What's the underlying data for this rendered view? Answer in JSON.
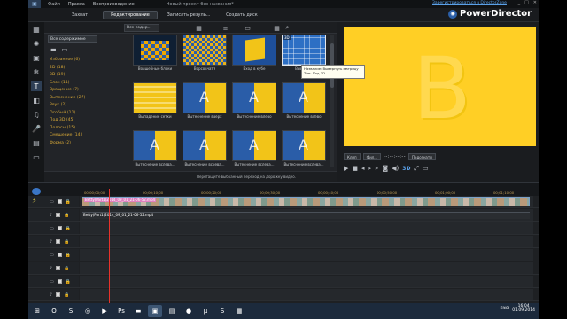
{
  "app": {
    "menu": [
      "Файл",
      "Правка",
      "Воспроизведение"
    ],
    "project_title": "Новый проект без названия*",
    "register_link": "Зарегистрироваться в DirectorZone",
    "brand": "PowerDirector",
    "window_buttons": [
      "_",
      "□",
      "✕"
    ]
  },
  "tabs": [
    {
      "label": "Захват",
      "active": false
    },
    {
      "label": "Редактирование",
      "active": true
    },
    {
      "label": "Записать резуль...",
      "active": false
    },
    {
      "label": "Создать диск",
      "active": false
    }
  ],
  "library": {
    "dropdown1": "Все содер...",
    "dropdown2": "Все содержимое",
    "categories": [
      "Избранное (6)",
      "2D (18)",
      "3D (19)",
      "Блок (11)",
      "Вращение (7)",
      "Вытеснение (27)",
      "Звук (2)",
      "Особый (11)",
      "Под 3D (45)",
      "Полосы (15)",
      "Смещение (14)",
      "Форма (2)"
    ],
    "thumbnails": [
      {
        "label": "Волшебные блоки",
        "style": "blocks"
      },
      {
        "label": "Ворсовчатя",
        "style": "mosaic"
      },
      {
        "label": "Вход в кубе",
        "style": "cube"
      },
      {
        "label": "Выверн...",
        "style": "grid3d",
        "badge": "3D",
        "selected": true
      },
      {
        "label": "Выпадение сетки",
        "style": "stripes"
      },
      {
        "label": "Вытеснение вверх",
        "style": "swipe"
      },
      {
        "label": "Вытеснение влево",
        "style": "swipe"
      },
      {
        "label": "Вытеснение влево",
        "style": "swipe"
      },
      {
        "label": "Вытеснение вслева...",
        "style": "swipe"
      },
      {
        "label": "Вытеснение вслева...",
        "style": "swipe"
      },
      {
        "label": "Вытеснение вслева...",
        "style": "swipe"
      },
      {
        "label": "Вытеснение вслева...",
        "style": "swipe"
      }
    ],
    "tooltip_name": "Название: Вывернуть матрицу",
    "tooltip_type": "Тип: Под 3D",
    "hint": "Перетащите выбранный переход на дорожку видео."
  },
  "preview": {
    "big_letter": "B",
    "mode_clip": "Клип",
    "mode_film": "Фил...",
    "timecode": "--:--:--:--",
    "fit_button": "Подогнати",
    "d3_label": "3D"
  },
  "timeline": {
    "ruler": [
      "00;00;00;00",
      "00;00;10;00",
      "00;00;20;00",
      "00;00;30;00",
      "00;00;40;00",
      "00;00;50;00",
      "00;01;00;00",
      "00;01;10;00"
    ],
    "clip_label_video": "Betty(Part1)2014_09_01_21-06-52.mp4",
    "clip_label_audio": "Betty(Part1)2014_09_01_21-06-52.mp4",
    "track_count": 8
  },
  "taskbar": {
    "icons": [
      "start-icon",
      "opera-icon",
      "skype-icon",
      "browser-icon",
      "media-icon",
      "photoshop-icon",
      "folder-icon",
      "powerdirector-icon",
      "explorer-icon",
      "record-icon",
      "torrent-icon",
      "skype2-icon",
      "app-icon"
    ],
    "lang": "ENG",
    "time": "16:04",
    "date": "01.09.2014"
  },
  "colors": {
    "accent_yellow": "#ffcf25",
    "category_text": "#d4a637",
    "playhead": "#e8322a",
    "brand_blue": "#2b5fa8"
  }
}
